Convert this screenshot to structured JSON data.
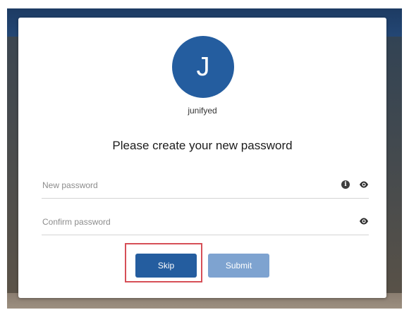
{
  "user": {
    "avatar_initial": "J",
    "username": "junifyed"
  },
  "form": {
    "title": "Please create your new password",
    "new_password": {
      "placeholder": "New password",
      "value": ""
    },
    "confirm_password": {
      "placeholder": "Confirm password",
      "value": ""
    },
    "info_icon": "info-icon",
    "show_password_icon": "eye-icon"
  },
  "buttons": {
    "skip_label": "Skip",
    "submit_label": "Submit",
    "skip_highlighted": true
  },
  "colors": {
    "primary": "#245d9f",
    "primary_disabled": "#7ea3d0",
    "highlight": "#d64f57"
  }
}
